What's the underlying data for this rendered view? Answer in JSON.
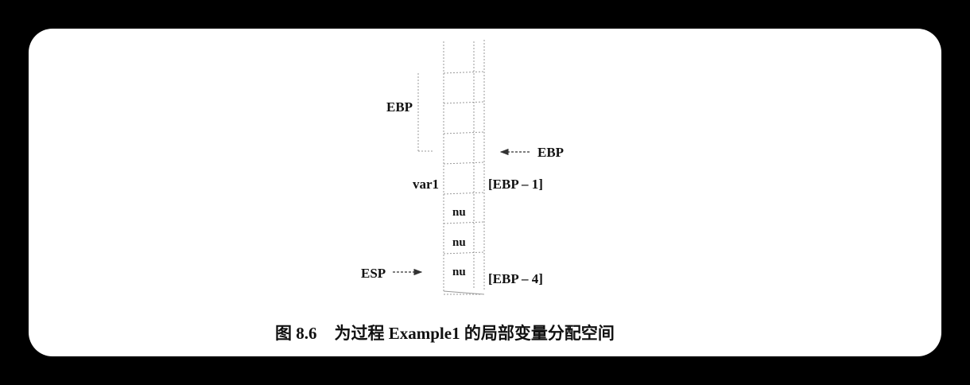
{
  "figure": {
    "labels": {
      "ebp_saved": "EBP",
      "ebp_pointer": "EBP",
      "var1_name": "var1",
      "var1_address": "[EBP – 1]",
      "cell_1": "nu",
      "cell_2": "nu",
      "cell_3": "nu",
      "esp_pointer": "ESP",
      "last_address": "[EBP – 4]"
    },
    "caption": {
      "number": "图 8.6",
      "text": "为过程 Example1 的局部变量分配空间"
    }
  }
}
